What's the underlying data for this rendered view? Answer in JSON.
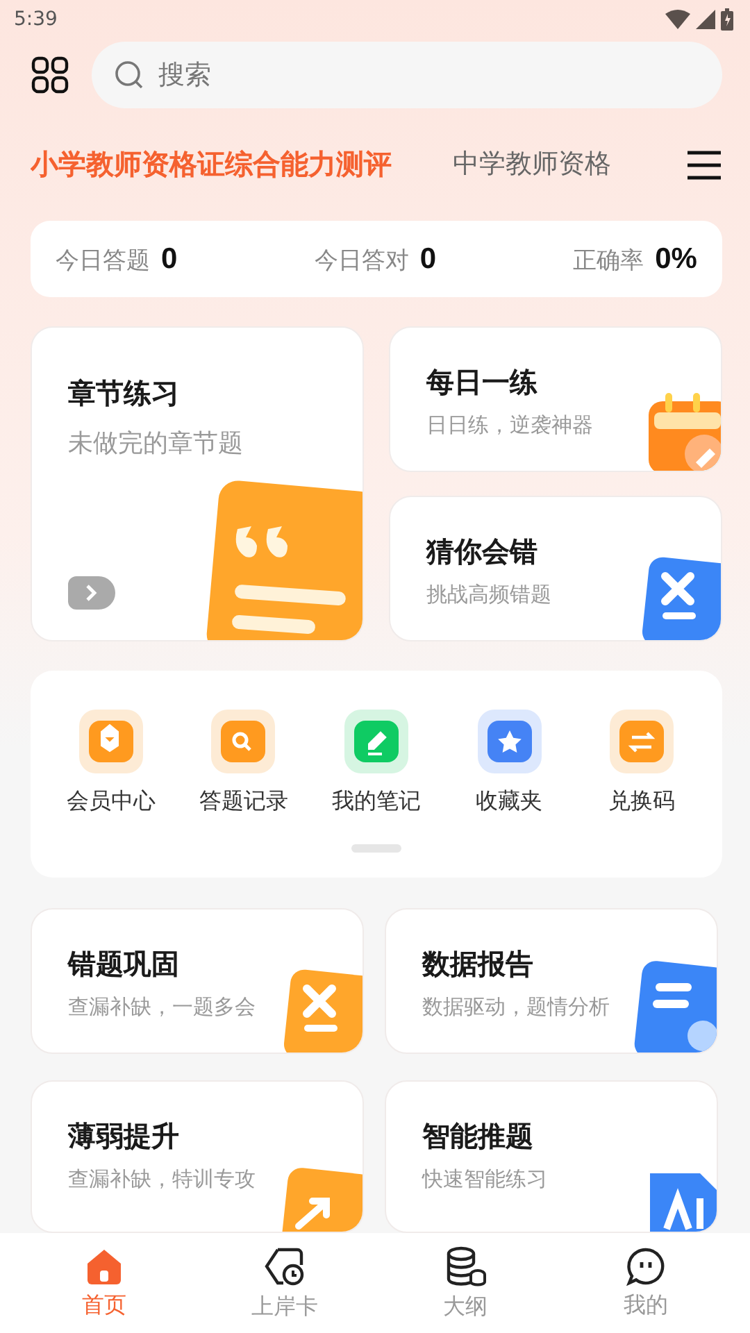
{
  "status_bar": {
    "time": "5:39"
  },
  "search": {
    "placeholder": "搜索"
  },
  "subject_tabs": [
    {
      "label": "小学教师资格证综合能力测评",
      "selected": true
    },
    {
      "label": "中学教师资格",
      "selected": false
    }
  ],
  "stats": [
    {
      "label": "今日答题",
      "value": "0"
    },
    {
      "label": "今日答对",
      "value": "0"
    },
    {
      "label": "正确率",
      "value": "0%"
    }
  ],
  "feature_cards": [
    {
      "kind": "quote",
      "title": "章节练习",
      "subtitle": "未做完的章节题"
    },
    {
      "kind": "calendar",
      "title": "每日一练",
      "subtitle": "日日练，逆袭神器"
    },
    {
      "kind": "wrong",
      "title": "猜你会错",
      "subtitle": "挑战高频错题"
    }
  ],
  "shortcuts": [
    {
      "kind": "member",
      "label": "会员中心"
    },
    {
      "kind": "record",
      "label": "答题记录"
    },
    {
      "kind": "note",
      "label": "我的笔记"
    },
    {
      "kind": "favorite",
      "label": "收藏夹"
    },
    {
      "kind": "redeem",
      "label": "兑换码"
    }
  ],
  "tools": [
    {
      "kind": "wrong",
      "title": "错题巩固",
      "subtitle": "查漏补缺，一题多会"
    },
    {
      "kind": "report",
      "title": "数据报告",
      "subtitle": "数据驱动，题情分析"
    },
    {
      "kind": "trend",
      "title": "薄弱提升",
      "subtitle": "查漏补缺，特训专攻"
    },
    {
      "kind": "ai",
      "title": "智能推题",
      "subtitle": "快速智能练习"
    }
  ],
  "bottom_nav": [
    {
      "kind": "home",
      "label": "首页",
      "selected": true
    },
    {
      "kind": "card",
      "label": "上岸卡",
      "selected": false
    },
    {
      "kind": "outline",
      "label": "大纲",
      "selected": false
    },
    {
      "kind": "me",
      "label": "我的",
      "selected": false
    }
  ]
}
